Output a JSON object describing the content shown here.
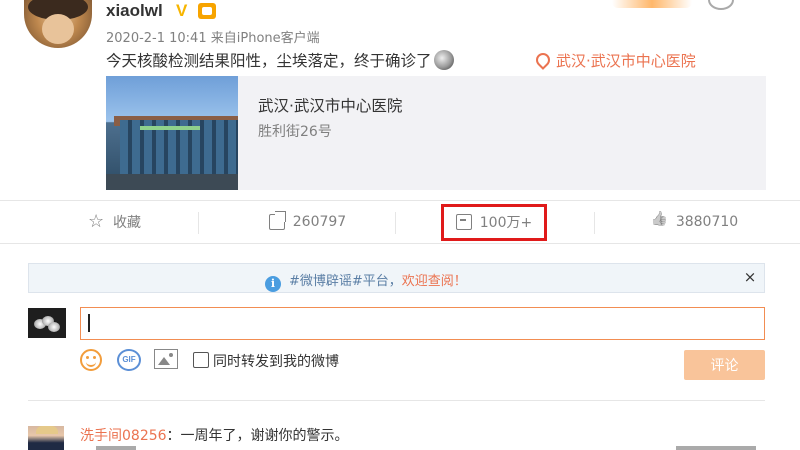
{
  "post": {
    "username": "xiaolwl",
    "verified_badge": "V",
    "date": "2020-2-1 10:41",
    "source_prefix": "来自",
    "source": "iPhone客户端",
    "text": "今天核酸检测结果阳性，尘埃落定，终于确诊了",
    "location_tag": "武汉·武汉市中心医院",
    "location_card": {
      "title": "武汉·武汉市中心医院",
      "address": "胜利街26号"
    }
  },
  "actions": {
    "favorite_label": "收藏",
    "repost_count": "260797",
    "comment_count": "100万+",
    "like_count": "3880710"
  },
  "notice": {
    "info_icon": "i",
    "text": "#微博辟谣#平台，",
    "link": "欢迎查阅！",
    "close": "×"
  },
  "composer": {
    "input_value": "",
    "repost_label": "同时转发到我的微博",
    "gif_label": "GIF",
    "submit_label": "评论"
  },
  "comments": [
    {
      "user": "洗手间08256",
      "separator": "：",
      "text": "一周年了，谢谢你的警示。"
    }
  ],
  "colors": {
    "accent": "#eb7350",
    "highlight_box": "#e01a1a",
    "notice_text": "#5a7ea5",
    "submit_disabled": "#f9c49a"
  },
  "icons": [
    "location-pin-icon",
    "star-icon",
    "share-icon",
    "comment-icon",
    "like-icon",
    "info-icon",
    "close-icon",
    "emoji-icon",
    "gif-icon",
    "image-icon"
  ]
}
